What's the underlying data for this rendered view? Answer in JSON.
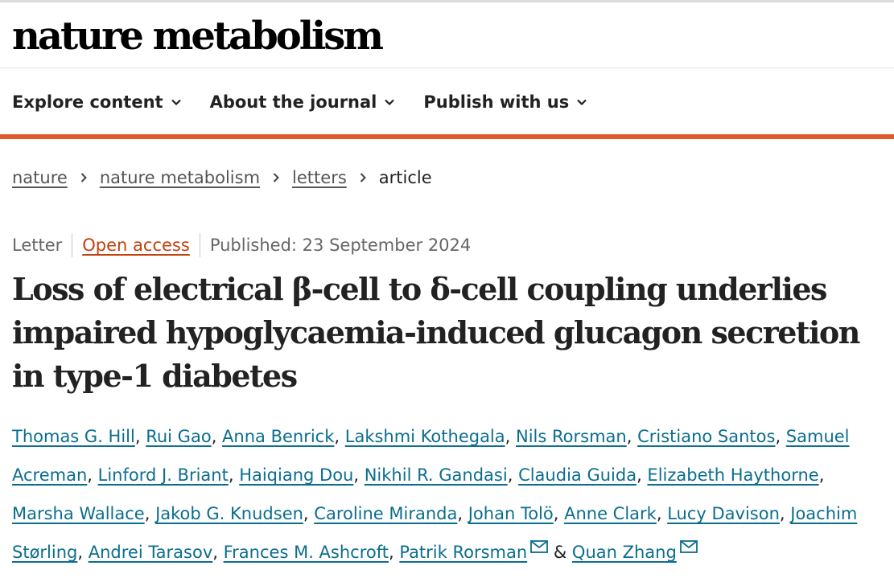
{
  "journal": {
    "logo_text": "nature metabolism"
  },
  "nav": {
    "items": [
      "Explore content",
      "About the journal",
      "Publish with us"
    ]
  },
  "breadcrumb": {
    "items": [
      "nature",
      "nature metabolism",
      "letters"
    ],
    "current": "article"
  },
  "article": {
    "type": "Letter",
    "access": "Open access",
    "published": "Published: 23 September 2024",
    "title": "Loss of electrical β-cell to δ-cell coupling underlies impaired hypoglycaemia-induced glucagon secretion in type-1 diabetes",
    "authors": [
      "Thomas G. Hill",
      "Rui Gao",
      "Anna Benrick",
      "Lakshmi Kothegala",
      "Nils Rorsman",
      "Cristiano Santos",
      "Samuel Acreman",
      "Linford J. Briant",
      "Haiqiang Dou",
      "Nikhil R. Gandasi",
      "Claudia Guida",
      "Elizabeth Haythorne",
      "Marsha Wallace",
      "Jakob G. Knudsen",
      "Caroline Miranda",
      "Johan Tolö",
      "Anne Clark",
      "Lucy Davison",
      "Joachim Størling",
      "Andrei Tarasov",
      "Frances M. Ashcroft",
      "Patrik Rorsman",
      "Quan Zhang"
    ],
    "author_separator": ", ",
    "author_conjunction": "&",
    "corresponding": [
      "Patrik Rorsman",
      "Quan Zhang"
    ]
  },
  "colors": {
    "accent": "#e05a2b",
    "link": "#0b6e8e",
    "open_access": "#c2410c"
  }
}
